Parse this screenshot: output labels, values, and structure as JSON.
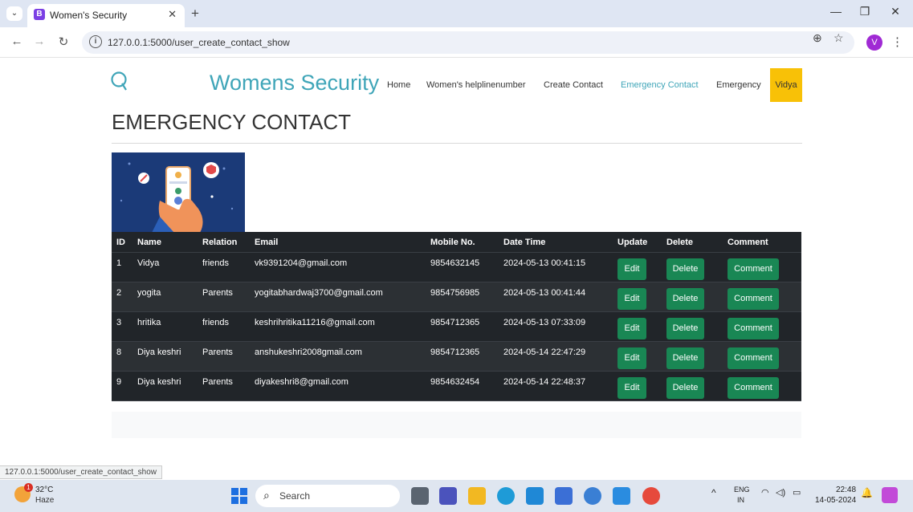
{
  "browser": {
    "tab_title": "Women's Security",
    "tab_favicon": "B",
    "url": "127.0.0.1:5000/user_create_contact_show",
    "profile_initial": "V",
    "status_url": "127.0.0.1:5000/user_create_contact_show"
  },
  "site": {
    "brand": "Womens Security",
    "nav": [
      "Home",
      "Women's helplinenumber",
      "Create Contact",
      "Emergency Contact",
      "Emergency"
    ],
    "active_nav": "Emergency Contact",
    "user": "Vidya",
    "accent_color": "#3fa5b8",
    "user_button_color": "#f8c107"
  },
  "page": {
    "title": "EMERGENCY CONTACT"
  },
  "table": {
    "headers": [
      "ID",
      "Name",
      "Relation",
      "Email",
      "Mobile No.",
      "Date Time",
      "Update",
      "Delete",
      "Comment"
    ],
    "rows": [
      {
        "id": "1",
        "name": "Vidya",
        "relation": "friends",
        "email": "vk9391204@gmail.com",
        "mobile": "9854632145",
        "datetime": "2024-05-13 00:41:15"
      },
      {
        "id": "2",
        "name": "yogita",
        "relation": "Parents",
        "email": "yogitabhardwaj3700@gmail.com",
        "mobile": "9854756985",
        "datetime": "2024-05-13 00:41:44"
      },
      {
        "id": "3",
        "name": "hritika",
        "relation": "friends",
        "email": "keshrihritika11216@gmail.com",
        "mobile": "9854712365",
        "datetime": "2024-05-13 07:33:09"
      },
      {
        "id": "8",
        "name": "Diya keshri",
        "relation": "Parents",
        "email": "anshukeshri2008gmail.com",
        "mobile": "9854712365",
        "datetime": "2024-05-14 22:47:29"
      },
      {
        "id": "9",
        "name": "Diya keshri",
        "relation": "Parents",
        "email": "diyakeshri8@gmail.com",
        "mobile": "9854632454",
        "datetime": "2024-05-14 22:48:37"
      }
    ],
    "edit_label": "Edit",
    "delete_label": "Delete",
    "comment_label": "Comment",
    "button_color": "#198754"
  },
  "taskbar": {
    "weather_badge": "1",
    "temperature": "32°C",
    "weather": "Haze",
    "search_placeholder": "Search",
    "lang_top": "ENG",
    "lang_bottom": "IN",
    "time": "22:48",
    "date": "14-05-2024"
  }
}
